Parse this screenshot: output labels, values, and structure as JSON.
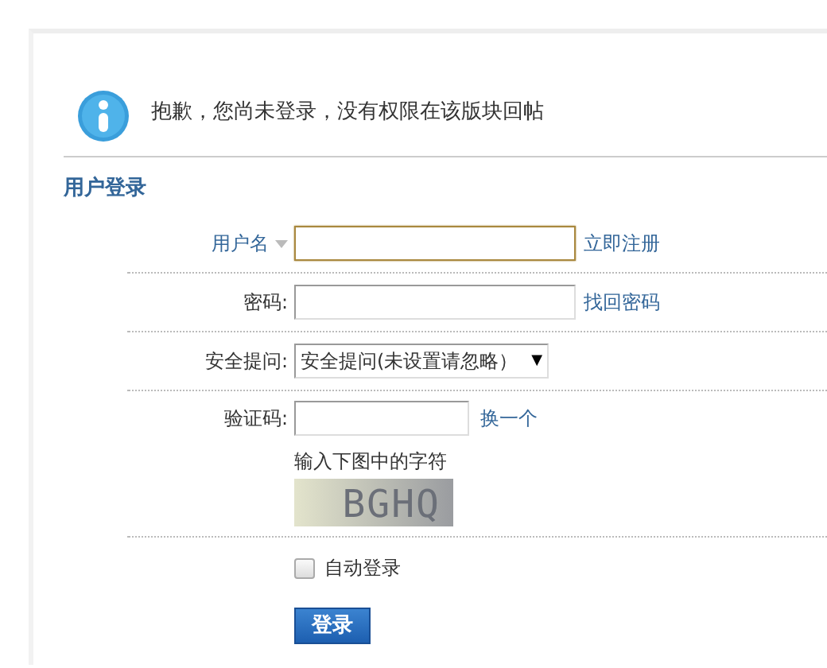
{
  "notice": {
    "message": "抱歉，您尚未登录，没有权限在该版块回帖"
  },
  "login": {
    "title": "用户登录",
    "username": {
      "label": "用户名",
      "link": "立即注册",
      "focused": true
    },
    "password": {
      "label": "密码:",
      "link": "找回密码"
    },
    "question": {
      "label": "安全提问:",
      "value": "安全提问(未设置请忽略）",
      "arrow": "▼"
    },
    "captcha": {
      "label": "验证码:",
      "link": "换一个",
      "hint": "输入下图中的字符",
      "code": "BGHQ"
    },
    "auto_login": {
      "label": "自动登录",
      "checked": false
    },
    "submit": "登录"
  }
}
